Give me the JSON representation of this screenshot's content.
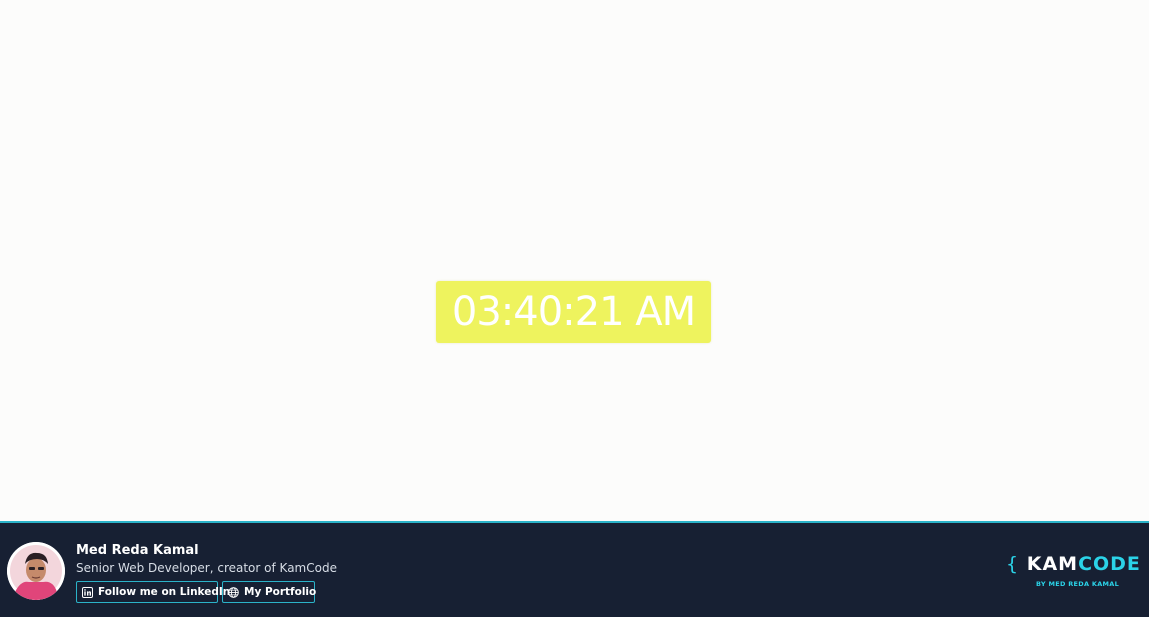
{
  "clock": {
    "time": "03:40:21 AM"
  },
  "footer": {
    "author_name": "Med Reda Kamal",
    "author_role": "Senior Web Developer, creator of KamCode",
    "linkedin_label": "Follow me on LinkedIn",
    "portfolio_label": "My Portfolio",
    "logo": {
      "open_brace": "{",
      "kam": "KAM",
      "code": "CODE",
      "close_brace": "}",
      "tagline": "BY MED REDA KAMAL"
    }
  },
  "colors": {
    "clock_bg": "#eef35e",
    "footer_bg": "#172033",
    "accent": "#2bb3c9",
    "logo_accent": "#2bd3e8"
  },
  "icons": [
    "linkedin-icon",
    "globe-icon"
  ]
}
